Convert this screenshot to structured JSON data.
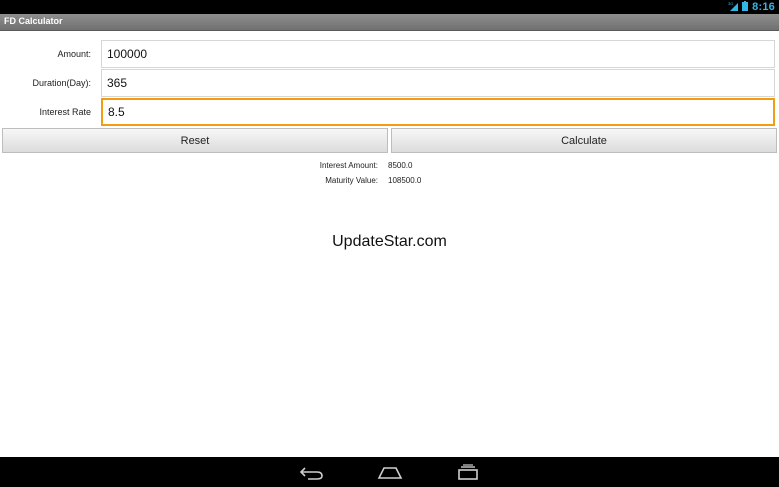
{
  "status_bar": {
    "network_label": "3G",
    "time": "8:16",
    "accent_color": "#33b5e5"
  },
  "app": {
    "title": "FD Calculator"
  },
  "form": {
    "amount": {
      "label": "Amount:",
      "value": "100000"
    },
    "duration": {
      "label": "Duration(Day):",
      "value": "365"
    },
    "interest_rate": {
      "label": "Interest Rate",
      "value": "8.5",
      "focused": true
    }
  },
  "buttons": {
    "reset_label": "Reset",
    "calculate_label": "Calculate"
  },
  "results": {
    "interest_amount": {
      "label": "Interest Amount:",
      "value": "8500.0"
    },
    "maturity_value": {
      "label": "Maturity Value:",
      "value": "108500.0"
    }
  },
  "watermark": "UpdateStar.com",
  "nav_bar": {
    "icons": [
      "back-icon",
      "home-icon",
      "recent-apps-icon"
    ]
  },
  "colors": {
    "focus_border": "#f39c12",
    "title_bar": "#7f7f7f"
  }
}
